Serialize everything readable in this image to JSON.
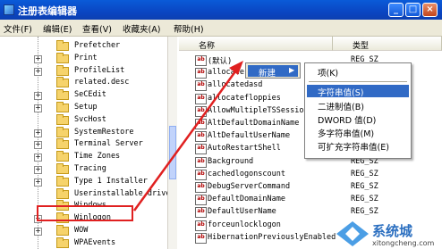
{
  "window": {
    "title": "注册表编辑器"
  },
  "menu": [
    "文件(F)",
    "编辑(E)",
    "查看(V)",
    "收藏夹(A)",
    "帮助(H)"
  ],
  "tree": {
    "items": [
      {
        "label": "Prefetcher",
        "expander": ""
      },
      {
        "label": "Print",
        "expander": "+"
      },
      {
        "label": "ProfileList",
        "expander": "+"
      },
      {
        "label": "related.desc",
        "expander": ""
      },
      {
        "label": "SeCEdit",
        "expander": "+"
      },
      {
        "label": "Setup",
        "expander": "+"
      },
      {
        "label": "SvcHost",
        "expander": ""
      },
      {
        "label": "SystemRestore",
        "expander": "+"
      },
      {
        "label": "Terminal Server",
        "expander": "+"
      },
      {
        "label": "Time Zones",
        "expander": "+"
      },
      {
        "label": "Tracing",
        "expander": "+"
      },
      {
        "label": "Type 1 Installer",
        "expander": "+"
      },
      {
        "label": "Userinstallable.driver",
        "expander": ""
      },
      {
        "label": "Windows",
        "expander": ""
      },
      {
        "label": "Winlogon",
        "expander": "+"
      },
      {
        "label": "WOW",
        "expander": "+"
      },
      {
        "label": "WPAEvents",
        "expander": ""
      }
    ]
  },
  "list": {
    "headers": {
      "name": "名称",
      "type": "类型"
    },
    "rows": [
      {
        "name": "(默认)",
        "type": "REG_SZ"
      },
      {
        "name": "allocate",
        "type": ""
      },
      {
        "name": "allocatedasd",
        "type": ""
      },
      {
        "name": "allocatefloppies",
        "type": ""
      },
      {
        "name": "AllowMultipleTSSession",
        "type": ""
      },
      {
        "name": "AltDefaultDomainName",
        "type": ""
      },
      {
        "name": "AltDefaultUserName",
        "type": ""
      },
      {
        "name": "AutoRestartShell",
        "type": ""
      },
      {
        "name": "Background",
        "type": "REG_SZ"
      },
      {
        "name": "cachedlogonscount",
        "type": "REG_SZ"
      },
      {
        "name": "DebugServerCommand",
        "type": "REG_SZ"
      },
      {
        "name": "DefaultDomainName",
        "type": "REG_SZ"
      },
      {
        "name": "DefaultUserName",
        "type": "REG_SZ"
      },
      {
        "name": "forceunlocklogon",
        "type": ""
      },
      {
        "name": "HibernationPreviouslyEnabled",
        "type": ""
      }
    ]
  },
  "context_menu": {
    "new_label": "新建",
    "new_arrow": "▶",
    "items": [
      "项(K)",
      "字符串值(S)",
      "二进制值(B)",
      "DWORD 值(D)",
      "多字符串值(M)",
      "可扩充字符串值(E)"
    ]
  },
  "watermark": {
    "brand": "系统城",
    "url": "xitongcheng.com"
  },
  "colors": {
    "highlight": "#316ac5",
    "annotation": "#e02020",
    "titlebar": "#0a46c3"
  }
}
